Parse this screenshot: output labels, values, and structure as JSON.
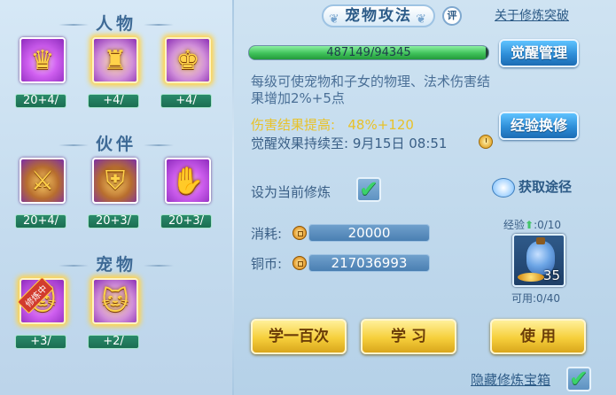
{
  "left": {
    "sections": [
      {
        "title": "人物",
        "slots": [
          {
            "label": "20+4/",
            "glow": false,
            "tile": "purple",
            "symbol": "♛"
          },
          {
            "label": "+4/",
            "glow": true,
            "tile": "gold",
            "symbol": "♜"
          },
          {
            "label": "+4/",
            "glow": true,
            "tile": "gold",
            "symbol": "♚"
          }
        ]
      },
      {
        "title": "伙伴",
        "slots": [
          {
            "label": "20+4/",
            "glow": false,
            "tile": "gold2",
            "symbol": "⚔"
          },
          {
            "label": "20+3/",
            "glow": false,
            "tile": "gold2",
            "symbol": "⛨"
          },
          {
            "label": "20+3/",
            "glow": false,
            "tile": "purple",
            "symbol": "✋"
          }
        ]
      },
      {
        "title": "宠物",
        "slots": [
          {
            "label": "+3/",
            "glow": true,
            "tile": "purple",
            "symbol": "🐱",
            "badge": "修炼中"
          },
          {
            "label": "+2/",
            "glow": true,
            "tile": "gold",
            "symbol": "🐱"
          }
        ]
      }
    ]
  },
  "header": {
    "title": "宠物攻法",
    "comment_label": "评",
    "about_link": "关于修炼突破"
  },
  "progress": {
    "text": "487149/94345",
    "fill_fraction": 0.99
  },
  "buttons": {
    "awaken_manage": "觉醒管理",
    "exp_exchange": "经验换修",
    "learn_hundred": "学一百次",
    "learn": "学 习",
    "use": "使 用"
  },
  "description": "每级可使宠物和子女的物理、法术伤害结果增加2%+5点",
  "stat": {
    "label": "伤害结果提高:",
    "value": "48%+120"
  },
  "expire": {
    "label": "觉醒效果持续至:",
    "value": "9月15日 08:51"
  },
  "set_current": {
    "label": "设为当前修炼",
    "checked": true
  },
  "obtain": {
    "label": "获取途径"
  },
  "consume": {
    "label": "消耗:",
    "value": "20000"
  },
  "copper": {
    "label": "铜币:",
    "value": "217036993"
  },
  "exp_item": {
    "exp_label": "经验",
    "exp_value": ":0/10",
    "count": "35",
    "usable": "可用:0/40"
  },
  "hide_chest": {
    "label": "隐藏修炼宝箱",
    "checked": true
  },
  "colors": {
    "accent_blue": "#2e8ed8",
    "gold_button": "#f6cf3b",
    "stat_yellow": "#e8c22a",
    "progress_green": "#3fc25a"
  }
}
